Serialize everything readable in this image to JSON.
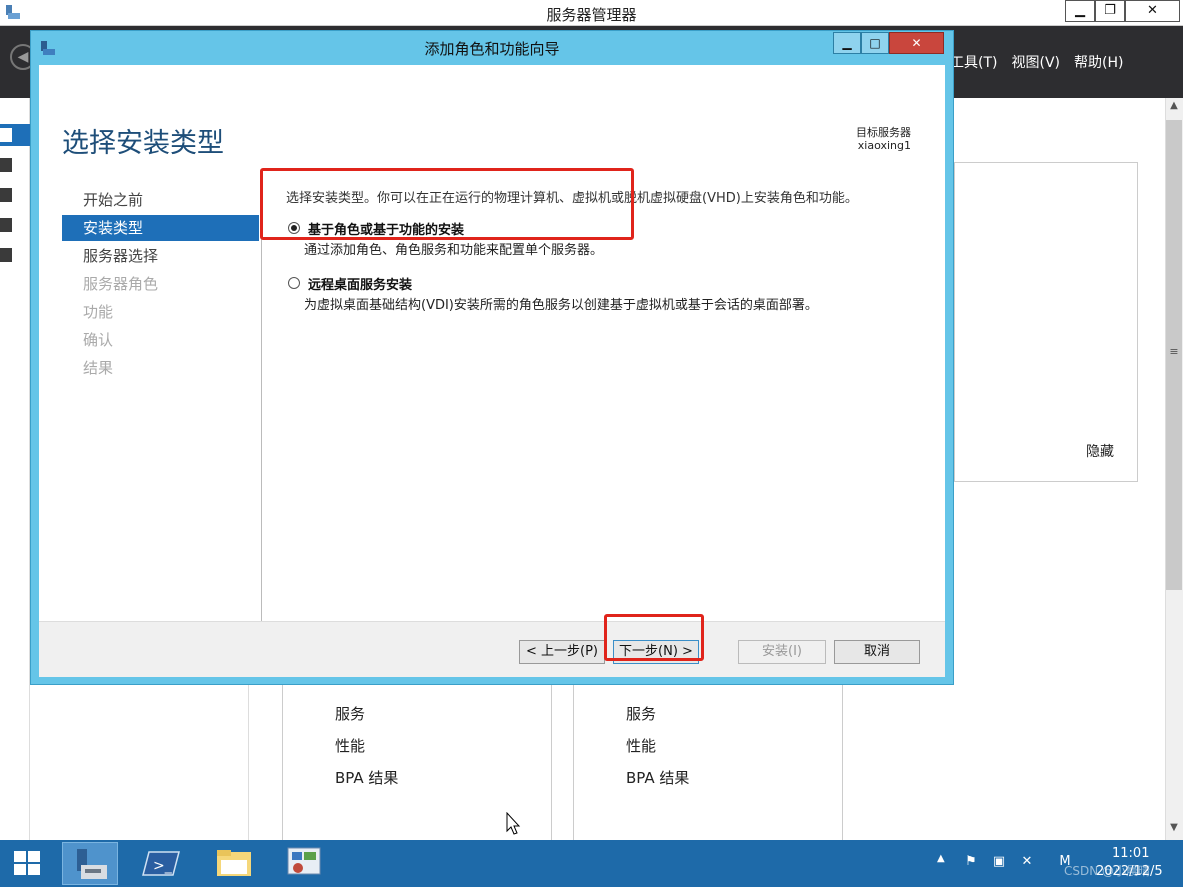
{
  "server_manager": {
    "title": "服务器管理器",
    "menus": [
      "工具(T)",
      "视图(V)",
      "帮助(H)"
    ],
    "hide_link": "隐藏",
    "lower_col1": [
      "服务",
      "性能",
      "BPA 结果"
    ],
    "lower_col2": [
      "服务",
      "性能",
      "BPA 结果"
    ]
  },
  "wizard": {
    "title": "添加角色和功能向导",
    "page_title": "选择安装类型",
    "destination_label": "目标服务器",
    "destination_server": "xiaoxing1",
    "nav": [
      {
        "label": "开始之前",
        "state": "done"
      },
      {
        "label": "安装类型",
        "state": "active"
      },
      {
        "label": "服务器选择",
        "state": "done"
      },
      {
        "label": "服务器角色",
        "state": "pending"
      },
      {
        "label": "功能",
        "state": "pending"
      },
      {
        "label": "确认",
        "state": "pending"
      },
      {
        "label": "结果",
        "state": "pending"
      }
    ],
    "intro": "选择安装类型。你可以在正在运行的物理计算机、虚拟机或脱机虚拟硬盘(VHD)上安装角色和功能。",
    "options": [
      {
        "label": "基于角色或基于功能的安装",
        "description": "通过添加角色、角色服务和功能来配置单个服务器。",
        "selected": true
      },
      {
        "label": "远程桌面服务安装",
        "description": "为虚拟桌面基础结构(VDI)安装所需的角色服务以创建基于虚拟机或基于会话的桌面部署。",
        "selected": false
      }
    ],
    "buttons": {
      "prev": "< 上一步(P)",
      "next": "下一步(N) >",
      "install": "安装(I)",
      "cancel": "取消"
    }
  },
  "taskbar": {
    "time": "11:01",
    "date": "2022/12/5",
    "watermark": "CSDN @小晨晴"
  },
  "colors": {
    "wizard_frame": "#65c5e8",
    "nav_active": "#1e6fb8",
    "highlight": "#e0241b",
    "taskbar": "#1e6aa9",
    "header": "#2d2d30"
  }
}
